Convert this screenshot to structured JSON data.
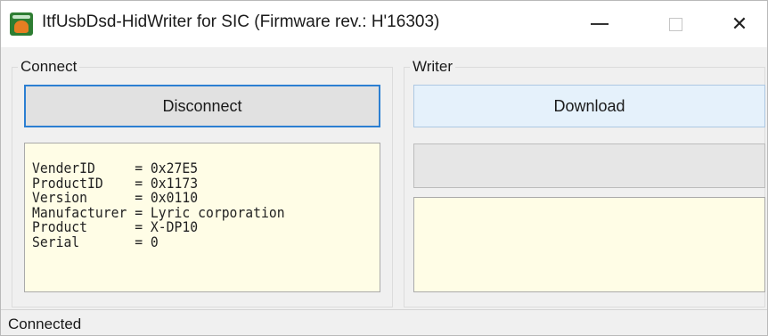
{
  "window": {
    "title": "ItfUsbDsd-HidWriter for SIC (Firmware rev.: H'16303)",
    "icon": "app-icon"
  },
  "connect": {
    "group_label": "Connect",
    "button_label": "Disconnect",
    "device_info": [
      "VenderID     = 0x27E5",
      "ProductID    = 0x1173",
      "Version      = 0x0110",
      "Manufacturer = Lyric corporation",
      "Product      = X-DP10",
      "Serial       = 0"
    ]
  },
  "writer": {
    "group_label": "Writer",
    "button_label": "Download",
    "progress_percent": 0,
    "log_text": ""
  },
  "status": {
    "text": "Connected"
  },
  "colors": {
    "info_background": "#fffde6",
    "focus_border": "#2c7fd2",
    "download_button_bg": "#e5f1fb"
  }
}
